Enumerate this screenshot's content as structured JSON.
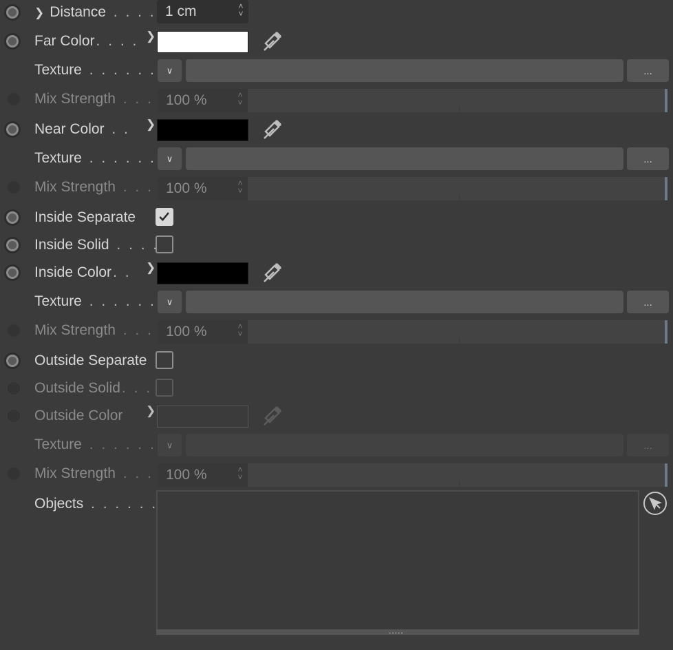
{
  "rows": {
    "distance": {
      "label": "Distance",
      "dots": " . . . .",
      "value": "1 cm"
    },
    "far_color": {
      "label": "Far Color",
      "dots": ". . . .",
      "color": "#ffffff"
    },
    "texture1": {
      "label": "Texture",
      "dots": " . . . . . . .",
      "more": "..."
    },
    "mix1": {
      "label": "Mix Strength",
      "dots": " . . .",
      "value": "100 %"
    },
    "near_color": {
      "label": "Near Color",
      "dots": "  . .",
      "color": "#000000"
    },
    "texture2": {
      "label": "Texture",
      "dots": " . . . . . . .",
      "more": "..."
    },
    "mix2": {
      "label": "Mix Strength",
      "dots": " . . .",
      "value": "100 %"
    },
    "inside_separate": {
      "label": "Inside Separate",
      "checked": true
    },
    "inside_solid": {
      "label": "Inside Solid",
      "dots": " . . . .",
      "checked": false
    },
    "inside_color": {
      "label": "Inside Color",
      "dots": ". .",
      "color": "#000000"
    },
    "texture3": {
      "label": "Texture",
      "dots": " . . . . . . .",
      "more": "..."
    },
    "mix3": {
      "label": "Mix Strength",
      "dots": " . . .",
      "value": "100 %"
    },
    "outside_separate": {
      "label": "Outside Separate",
      "checked": false
    },
    "outside_solid": {
      "label": "Outside Solid",
      "dots": ". . .",
      "checked": false
    },
    "outside_color": {
      "label": "Outside Color",
      "color": "#3b3b3b"
    },
    "texture4": {
      "label": "Texture",
      "dots": " . . . . . . .",
      "more": "..."
    },
    "mix4": {
      "label": "Mix Strength",
      "dots": " . . .",
      "value": "100 %"
    },
    "objects": {
      "label": "Objects",
      "dots": " . . . . . . .",
      "grip": "....."
    }
  },
  "icons": [
    "keyframe-circle-icon",
    "chevron-right-icon",
    "eyedropper-icon",
    "chevron-down-icon",
    "spinner-arrows-icon",
    "checkmark-icon",
    "pick-object-arrow-icon"
  ]
}
